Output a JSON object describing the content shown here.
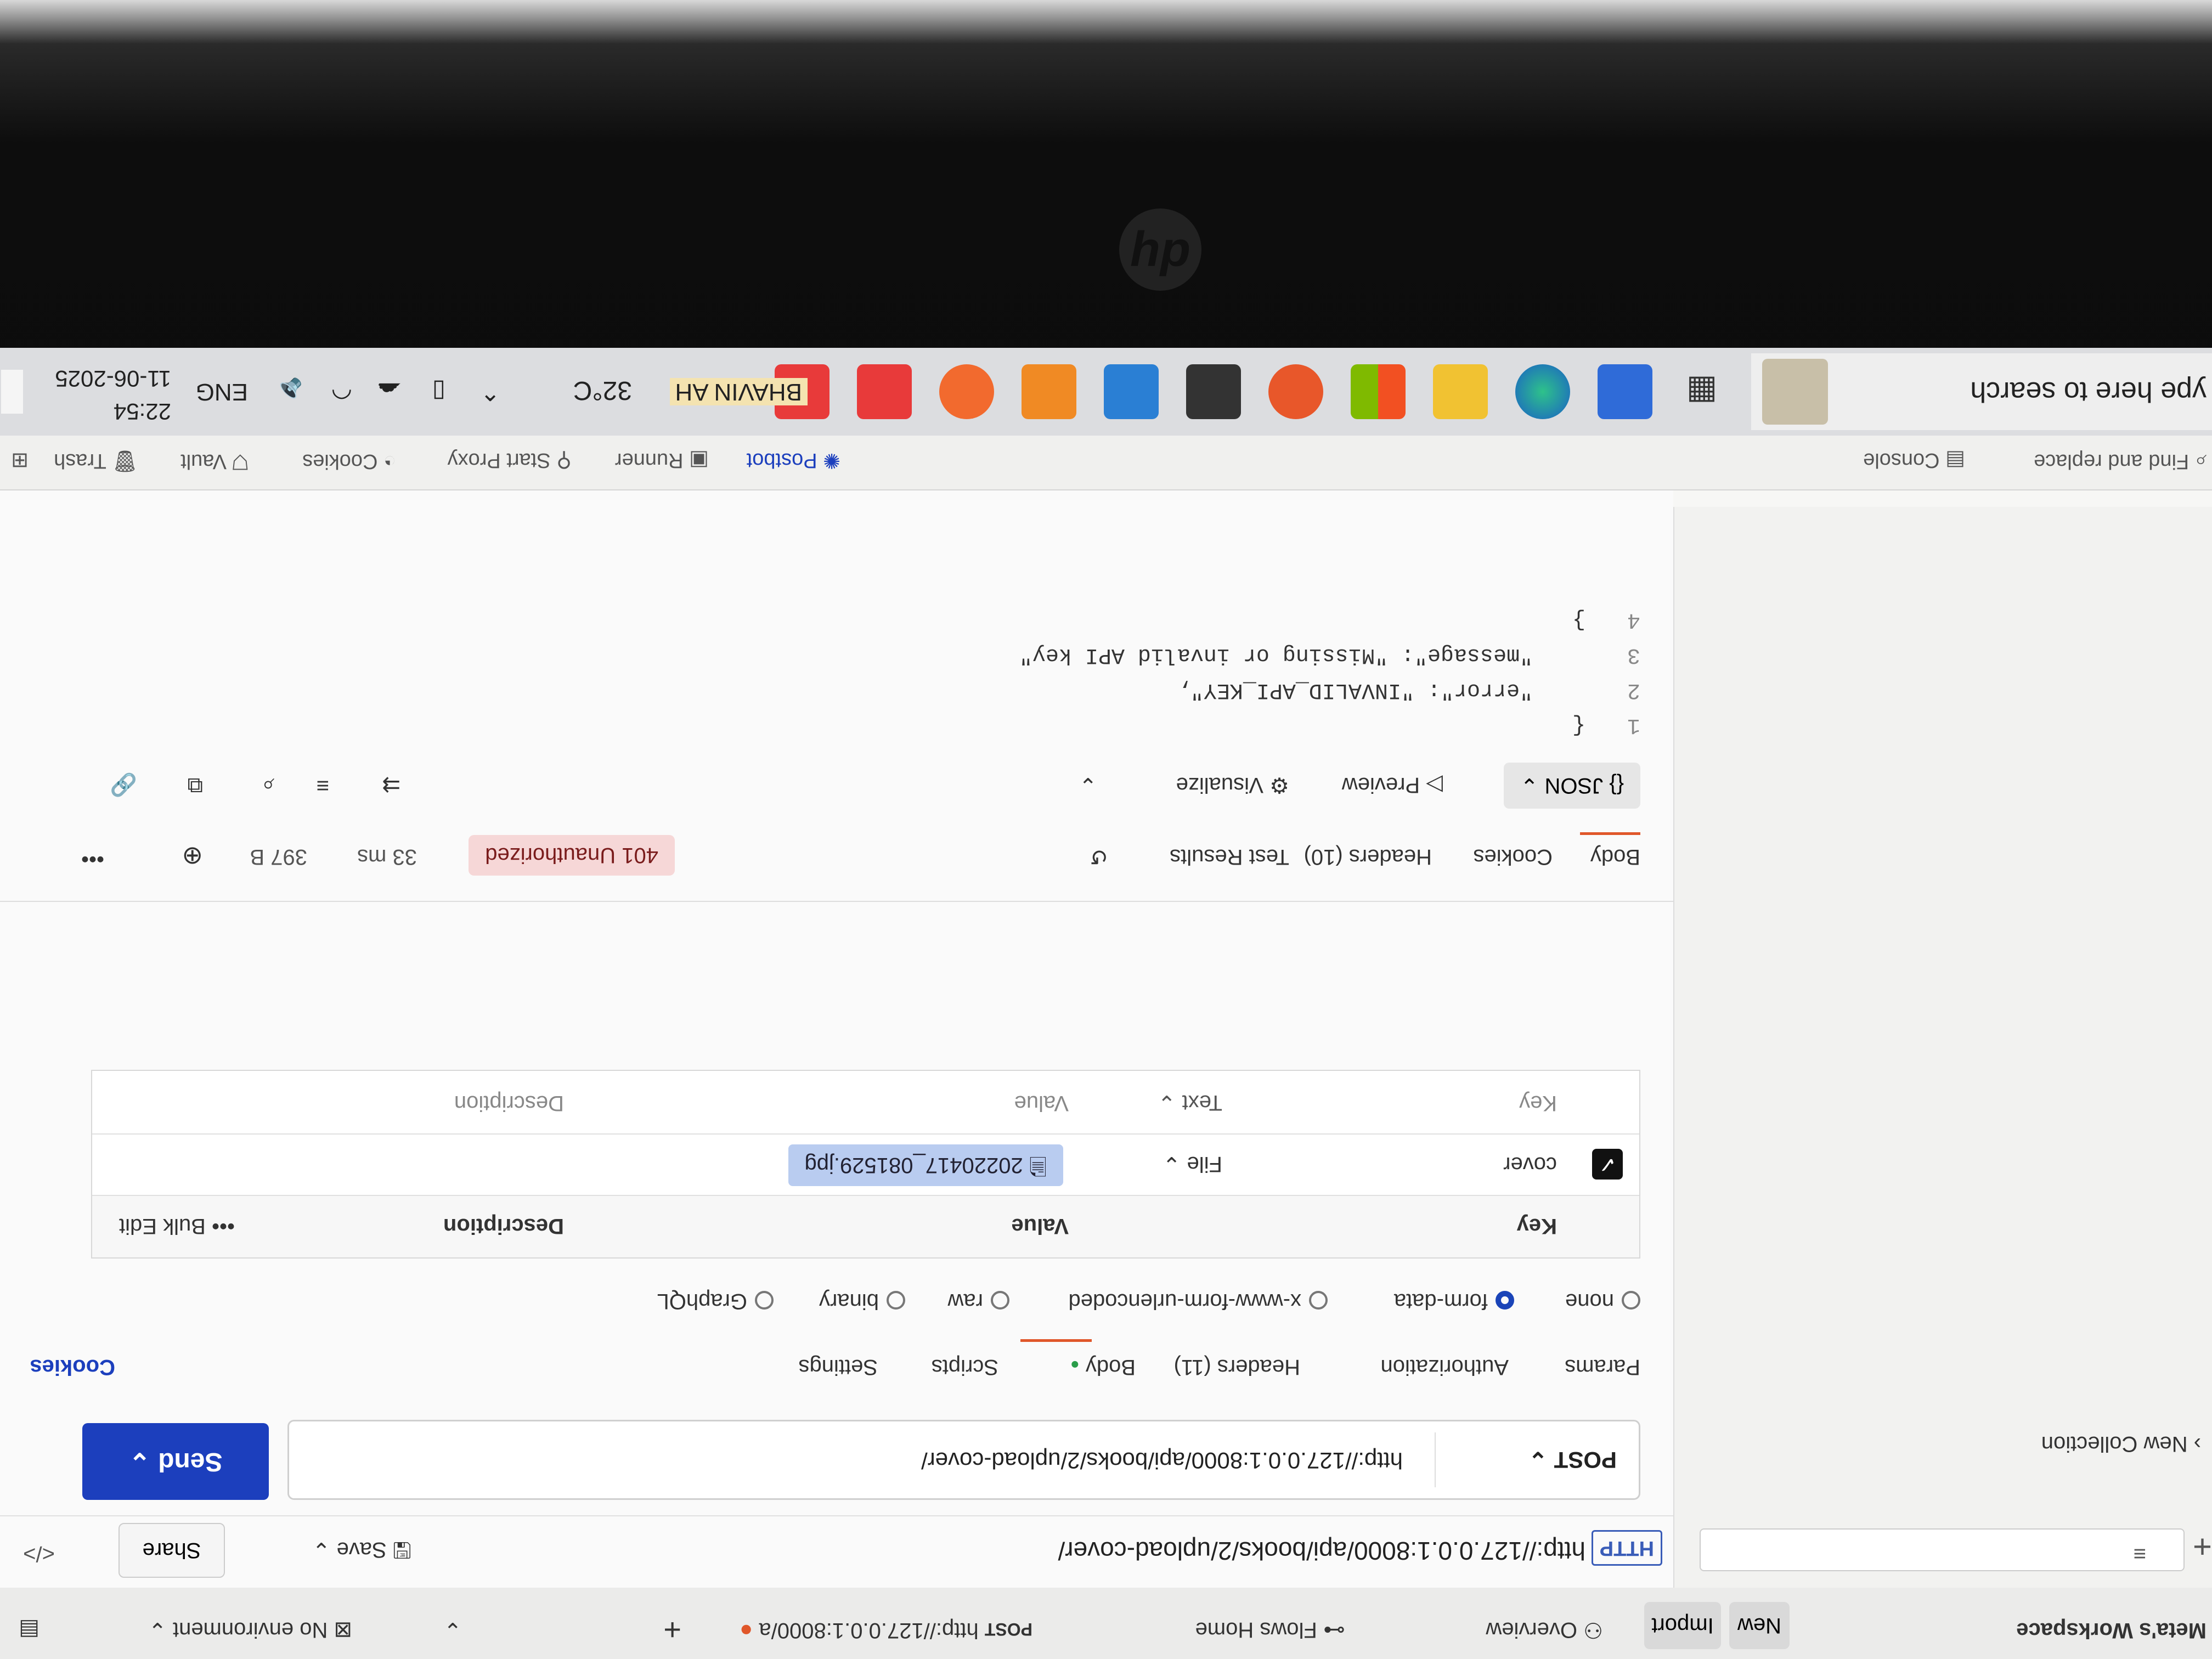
{
  "workspace": {
    "title": "Meta's Workspace",
    "new_label": "New",
    "import_label": "Import"
  },
  "tabs": {
    "overview_label": "Overview",
    "flows_label": "Flows Home",
    "request_tab_method": "POST",
    "request_tab_url": "http://127.0.0.1:8000/a",
    "environment_label": "No environment"
  },
  "sidebar": {
    "collection_label": "New Collection"
  },
  "request": {
    "title": "http://127.0.0.1:8000/api/books/2/upload-cover/",
    "save_label": "Save",
    "share_label": "Share",
    "method": "POST",
    "url": "http://127.0.0.1:8000/api/books/2/upload-cover/",
    "send_label": "Send"
  },
  "request_tabs": {
    "params": "Params",
    "authorization": "Authorization",
    "headers": "Headers (11)",
    "body": "Body",
    "scripts": "Scripts",
    "settings": "Settings",
    "cookies": "Cookies"
  },
  "body_types": {
    "none": "none",
    "form_data": "form-data",
    "urlencoded": "x-www-form-urlencoded",
    "raw": "raw",
    "binary": "binary",
    "graphql": "GraphQL"
  },
  "form_table": {
    "headers": {
      "key": "Key",
      "value": "Value",
      "description": "Description",
      "bulk_edit": "Bulk Edit"
    },
    "row": {
      "key": "cover",
      "type": "File",
      "file": "20220417_081529.jpg"
    },
    "placeholder": {
      "key": "Key",
      "type": "Text",
      "value": "Value",
      "description": "Description"
    }
  },
  "response": {
    "tabs": {
      "body": "Body",
      "cookies": "Cookies",
      "headers": "Headers (10)",
      "test_results": "Test Results"
    },
    "status": "401 Unauthorized",
    "time": "33 ms",
    "size": "397 B",
    "format_label": "JSON",
    "preview_label": "Preview",
    "visualize_label": "Visualize",
    "lines": [
      {
        "num": "1",
        "text": "{"
      },
      {
        "num": "2",
        "text": "    \"error\": \"INVALID_API_KEY\","
      },
      {
        "num": "3",
        "text": "    \"message\": \"Missing or invalid API key\""
      },
      {
        "num": "4",
        "text": "}"
      }
    ]
  },
  "statusbar": {
    "find_replace": "Find and replace",
    "console": "Console",
    "postbot": "Postbot",
    "runner": "Runner",
    "start_proxy": "Start Proxy",
    "cookies": "Cookies",
    "vault": "Vault",
    "trash": "Trash"
  },
  "taskbar": {
    "search_placeholder": "ype here to search",
    "weather": "32°C",
    "language": "ENG",
    "time": "22:54",
    "date": "11-06-2025",
    "overlay_name": "BHAVIN AH"
  },
  "colors": {
    "send_button": "#1c3fbd",
    "accent": "#e0572a",
    "status_badge": "#f6d7d7",
    "file_chip": "#b9ccf0"
  }
}
